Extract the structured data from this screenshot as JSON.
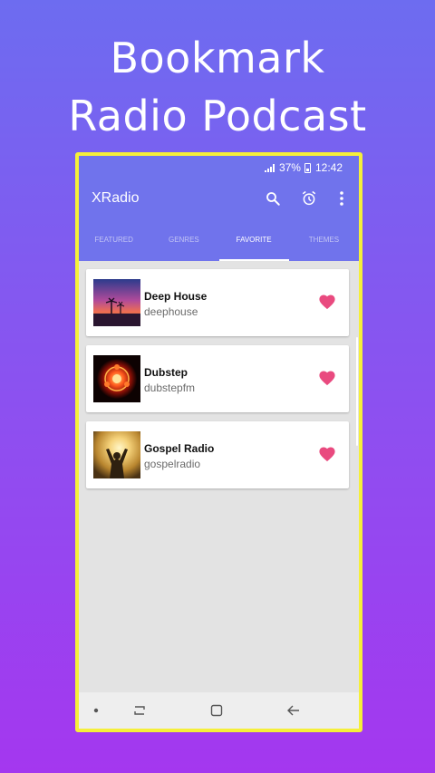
{
  "promo": {
    "line1": "Bookmark",
    "line2": "Radio Podcast"
  },
  "status_bar": {
    "battery": "37%",
    "time": "12:42"
  },
  "app": {
    "title": "XRadio",
    "accent_color": "#7073ec",
    "frame_color": "#f5ef3a"
  },
  "toolbar": {
    "icons": [
      "search-icon",
      "alarm-clock-icon",
      "more-vert-icon"
    ]
  },
  "tabs": [
    {
      "label": "FEATURED",
      "active": false
    },
    {
      "label": "GENRES",
      "active": false
    },
    {
      "label": "FAVORITE",
      "active": true
    },
    {
      "label": "THEMES",
      "active": false
    }
  ],
  "favorites": [
    {
      "name": "Deep House",
      "id": "deephouse",
      "favorited": true
    },
    {
      "name": "Dubstep",
      "id": "dubstepfm",
      "favorited": true
    },
    {
      "name": "Gospel Radio",
      "id": "gospelradio",
      "favorited": true
    }
  ],
  "favorite_color": "#e94a7f",
  "nav_bar": {
    "icons": [
      "dot-icon",
      "recent-apps-icon",
      "home-icon",
      "back-icon"
    ]
  }
}
